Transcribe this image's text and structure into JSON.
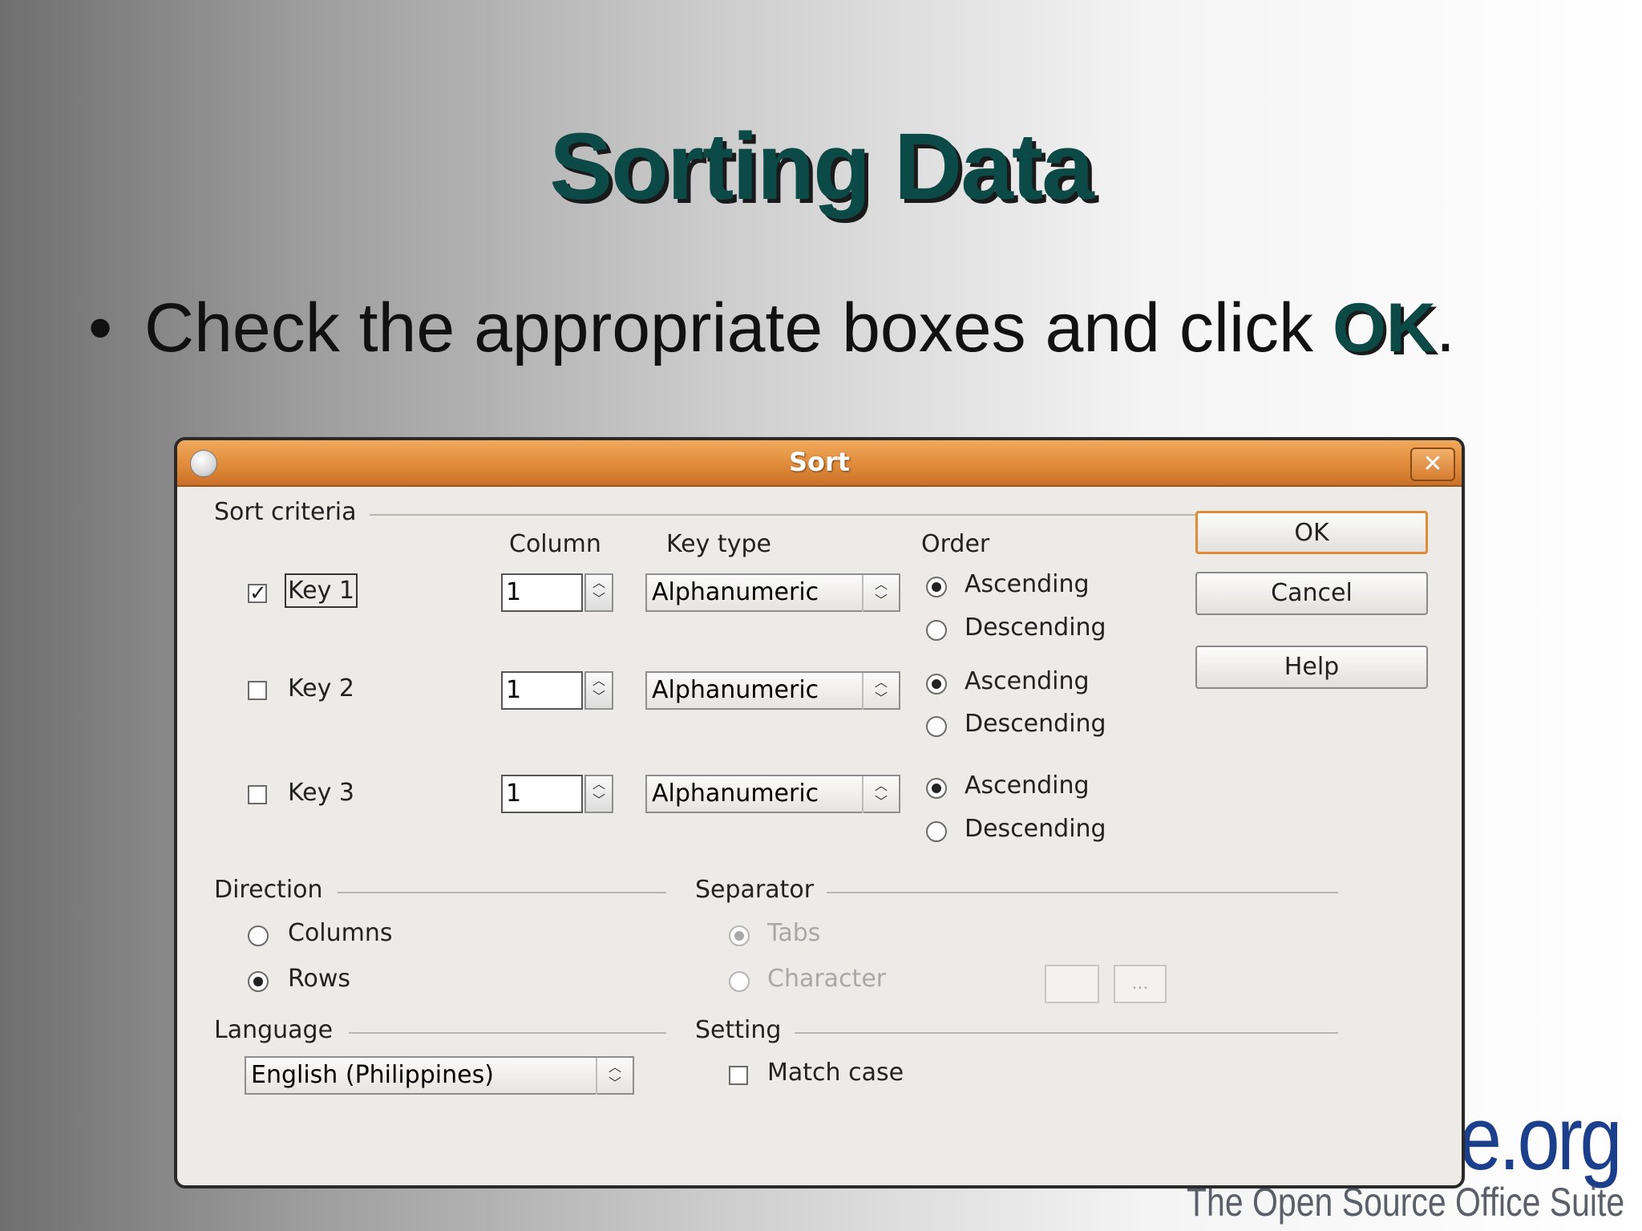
{
  "slide": {
    "title": "Sorting Data",
    "bullet_prefix": "Check the appropriate boxes and click ",
    "bullet_emphasis": "OK",
    "bullet_suffix": ".",
    "logo_org": "e.org",
    "logo_tagline": "The Open Source Office Suite"
  },
  "dialog": {
    "title": "Sort",
    "close_glyph": "✕",
    "sort_criteria": {
      "label": "Sort criteria",
      "headers": {
        "column": "Column",
        "key_type": "Key type",
        "order": "Order"
      },
      "keys": [
        {
          "label": "Key 1",
          "checked": true,
          "column": "1",
          "key_type": "Alphanumeric",
          "ascending": "Ascending",
          "descending": "Descending",
          "order": "Ascending"
        },
        {
          "label": "Key 2",
          "checked": false,
          "column": "1",
          "key_type": "Alphanumeric",
          "ascending": "Ascending",
          "descending": "Descending",
          "order": "Ascending"
        },
        {
          "label": "Key 3",
          "checked": false,
          "column": "1",
          "key_type": "Alphanumeric",
          "ascending": "Ascending",
          "descending": "Descending",
          "order": "Ascending"
        }
      ]
    },
    "direction": {
      "label": "Direction",
      "columns": "Columns",
      "rows": "Rows",
      "selected": "Rows"
    },
    "separator": {
      "label": "Separator",
      "tabs": "Tabs",
      "character": "Character",
      "selected": "Tabs",
      "browse": "..."
    },
    "language": {
      "label": "Language",
      "value": "English (Philippines)"
    },
    "setting": {
      "label": "Setting",
      "match_case": "Match case",
      "match_case_checked": false
    },
    "buttons": {
      "ok": "OK",
      "cancel": "Cancel",
      "help": "Help"
    }
  }
}
